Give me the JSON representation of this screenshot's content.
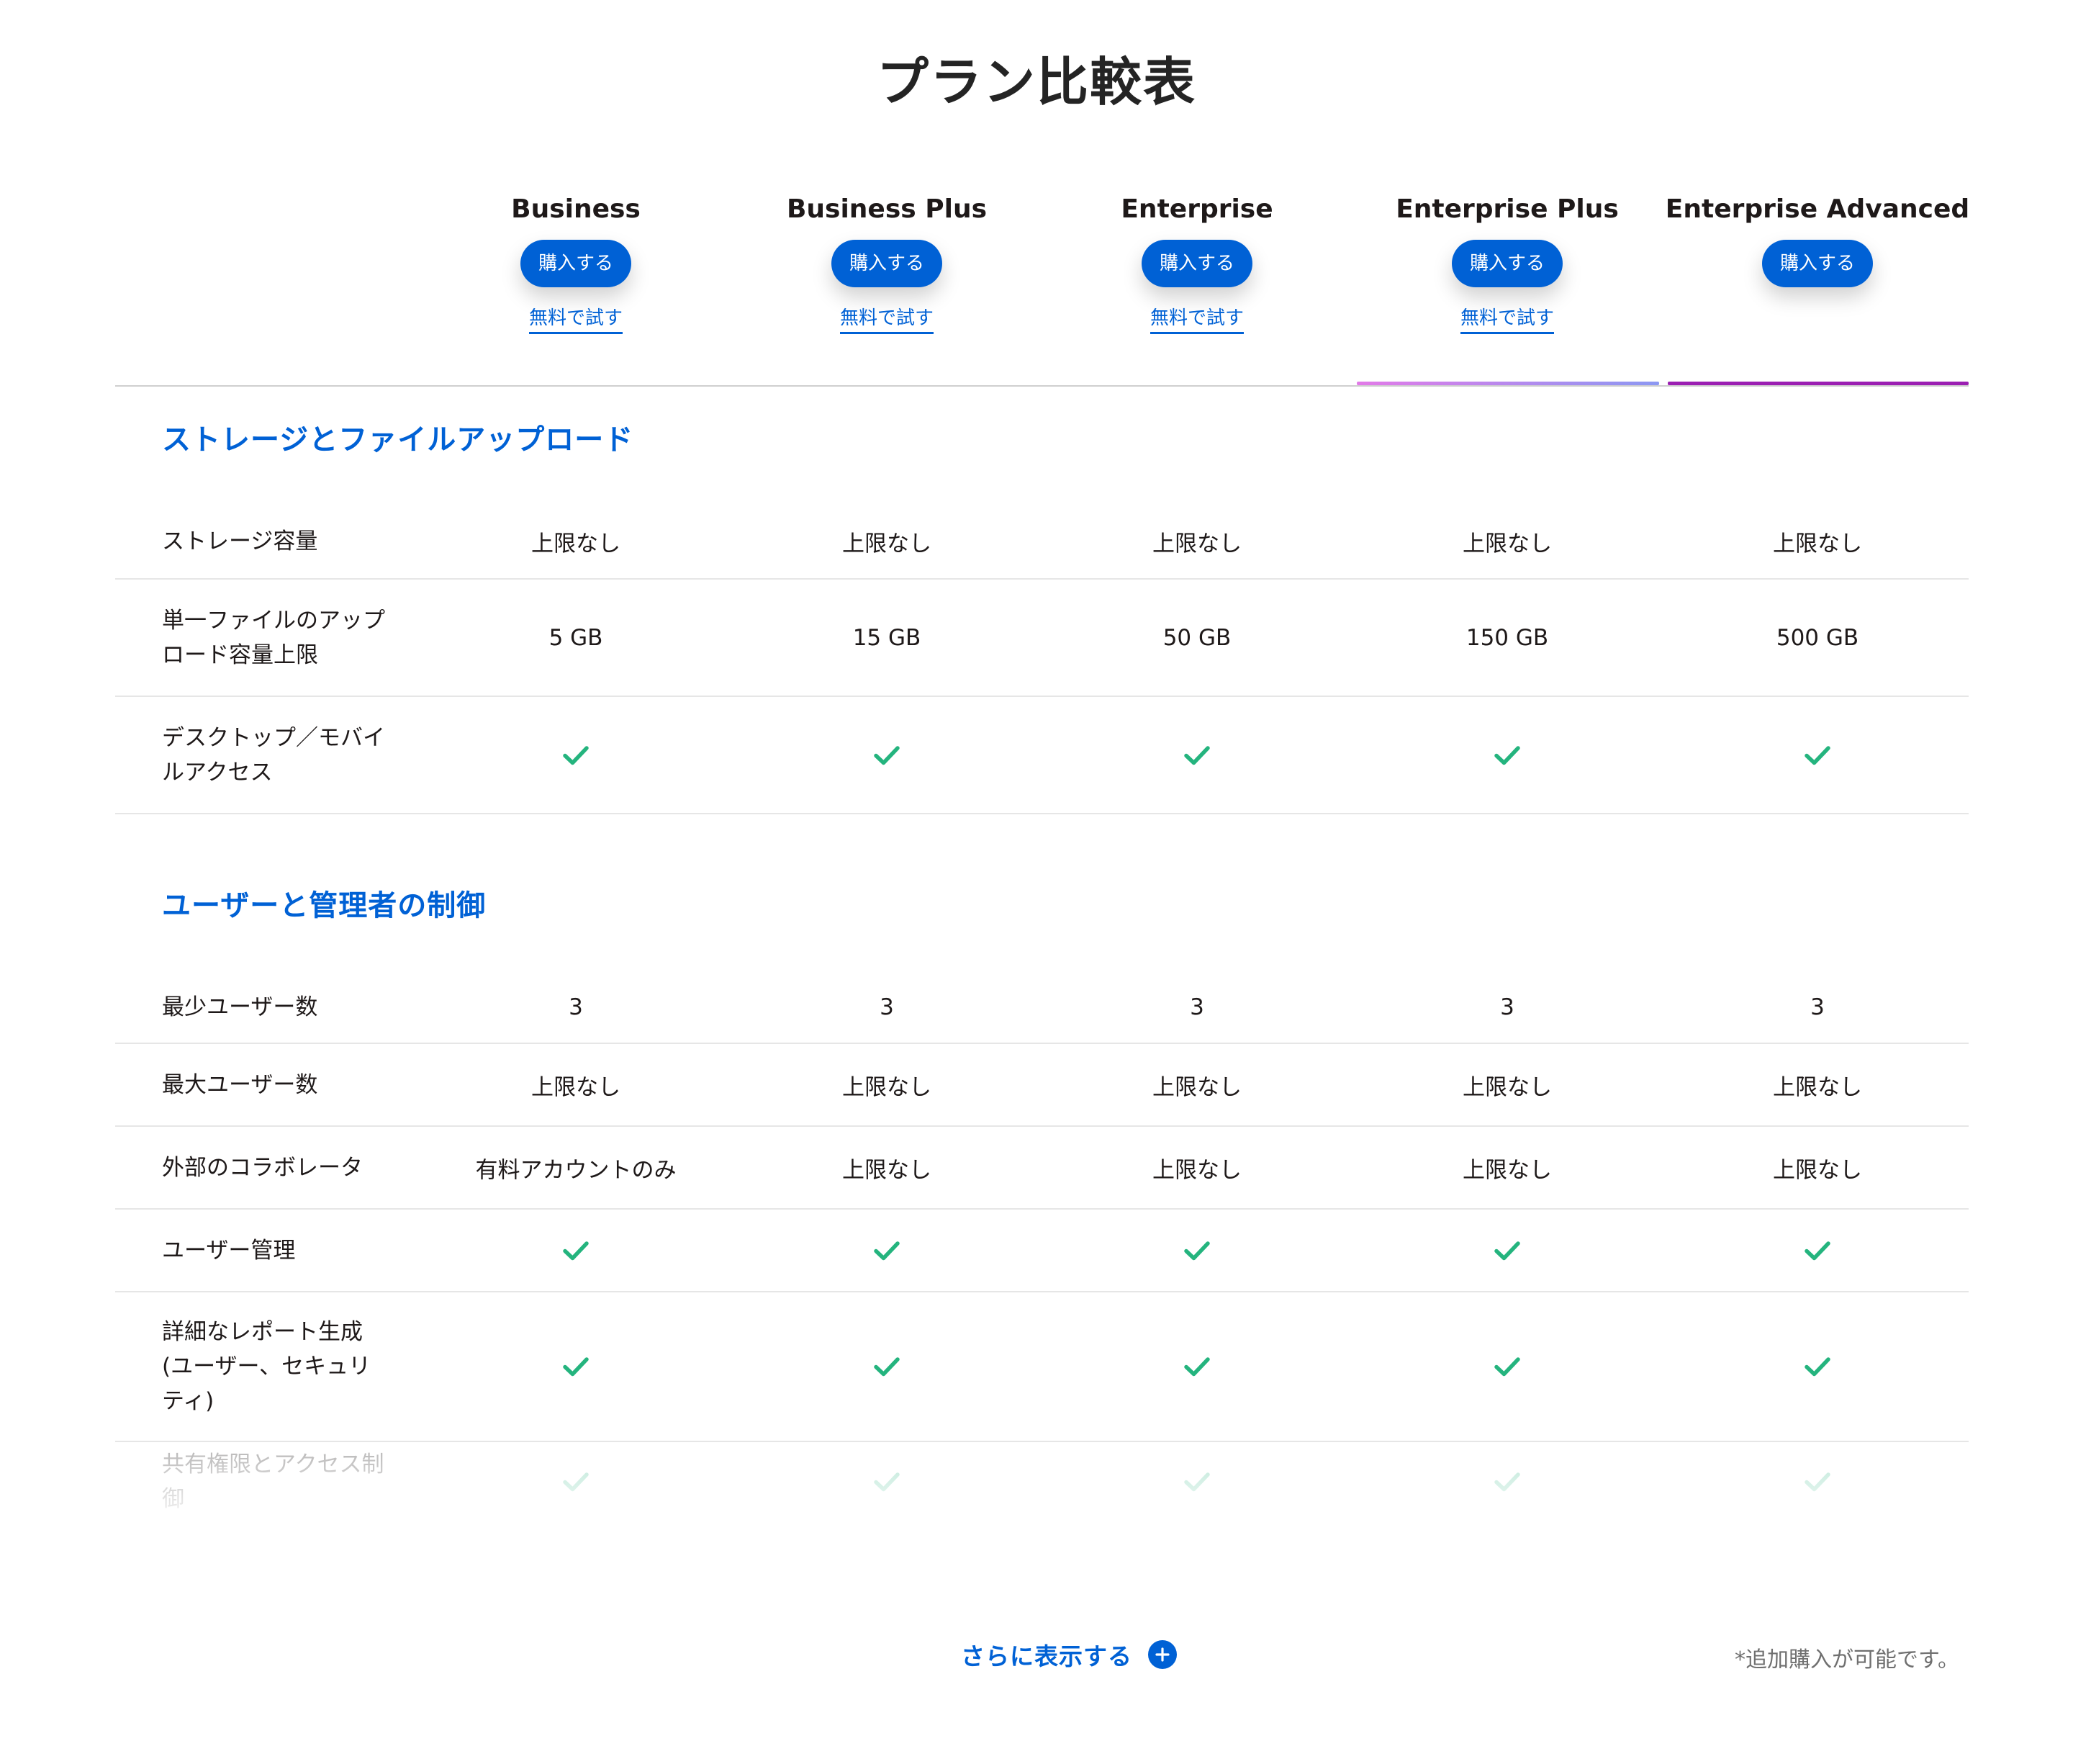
{
  "title": "プラン比較表",
  "plans": [
    {
      "name": "Business",
      "buy_label": "購入する",
      "trial_label": "無料で試す"
    },
    {
      "name": "Business Plus",
      "buy_label": "購入する",
      "trial_label": "無料で試す"
    },
    {
      "name": "Enterprise",
      "buy_label": "購入する",
      "trial_label": "無料で試す"
    },
    {
      "name": "Enterprise Plus",
      "buy_label": "購入する",
      "trial_label": "無料で試す"
    },
    {
      "name": "Enterprise Advanced",
      "buy_label": "購入する",
      "trial_label": ""
    }
  ],
  "colors": {
    "accent": "#0061d5",
    "check": "#24b47e",
    "enterprise_plus_underline_from": "#e27ae8",
    "enterprise_plus_underline_to": "#8c98f2",
    "enterprise_advanced_underline": "#9b1fb2"
  },
  "sections": [
    {
      "title": "ストレージとファイルアップロード",
      "rows": [
        {
          "label": "ストレージ容量",
          "values": [
            "上限なし",
            "上限なし",
            "上限なし",
            "上限なし",
            "上限なし"
          ]
        },
        {
          "label": "単一ファイルのアップロード容量上限",
          "values": [
            "5 GB",
            "15 GB",
            "50 GB",
            "150 GB",
            "500 GB"
          ]
        },
        {
          "label": "デスクトップ／モバイルアクセス",
          "values": [
            "check",
            "check",
            "check",
            "check",
            "check"
          ]
        }
      ]
    },
    {
      "title": "ユーザーと管理者の制御",
      "rows": [
        {
          "label": "最少ユーザー数",
          "values": [
            "3",
            "3",
            "3",
            "3",
            "3"
          ]
        },
        {
          "label": "最大ユーザー数",
          "values": [
            "上限なし",
            "上限なし",
            "上限なし",
            "上限なし",
            "上限なし"
          ]
        },
        {
          "label": "外部のコラボレータ",
          "values": [
            "有料アカウントのみ",
            "上限なし",
            "上限なし",
            "上限なし",
            "上限なし"
          ]
        },
        {
          "label": "ユーザー管理",
          "values": [
            "check",
            "check",
            "check",
            "check",
            "check"
          ]
        },
        {
          "label": "詳細なレポート生成(ユーザー、セキュリティ)",
          "values": [
            "check",
            "check",
            "check",
            "check",
            "check"
          ]
        },
        {
          "label": "共有権限とアクセス制御",
          "values": [
            "check",
            "check",
            "check",
            "check",
            "check"
          ]
        }
      ]
    }
  ],
  "show_more_label": "さらに表示する",
  "show_more_icon": "plus-circle-icon",
  "footnote": "*追加購入が可能です。"
}
